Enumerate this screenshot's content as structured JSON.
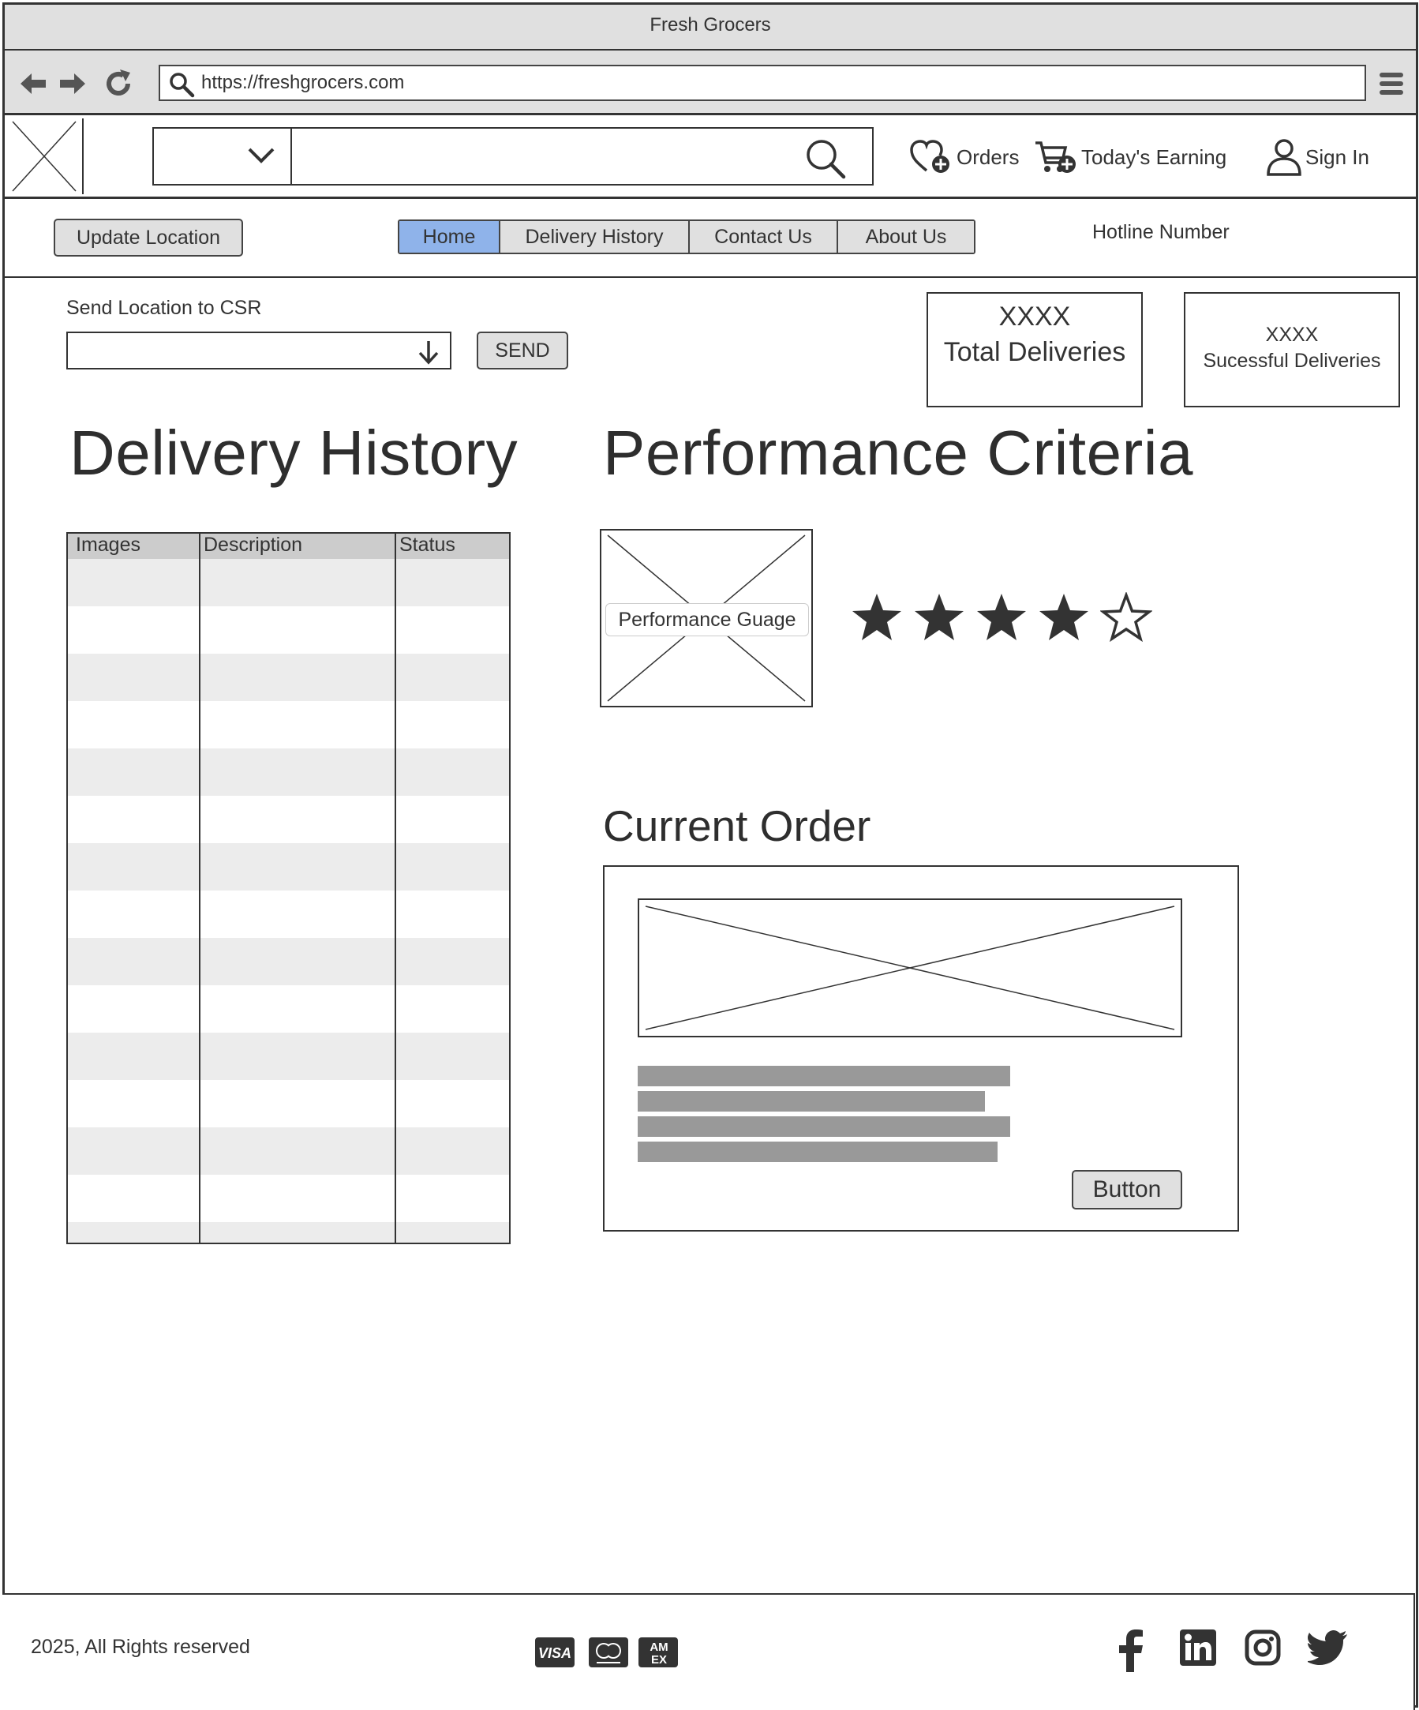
{
  "browser": {
    "title": "Fresh Grocers",
    "url": "https://freshgrocers.com"
  },
  "header": {
    "orders_label": "Orders",
    "earning_label": "Today's Earning",
    "signin_label": "Sign In"
  },
  "subnav": {
    "update_location": "Update Location",
    "tabs": [
      "Home",
      "Delivery History",
      "Contact Us",
      "About Us"
    ],
    "active_tab": "Home",
    "hotline": "Hotline Number"
  },
  "location": {
    "label": "Send Location to CSR",
    "send_button": "SEND"
  },
  "stats": {
    "total_value": "XXXX",
    "total_label": "Total Deliveries",
    "success_value": "XXXX",
    "success_label": "Sucessful Deliveries"
  },
  "delivery_history": {
    "title": "Delivery History",
    "columns": [
      "Images",
      "Description",
      "Status"
    ]
  },
  "performance": {
    "title": "Performance Criteria",
    "gauge_label": "Performance Guage",
    "rating": 4,
    "rating_max": 5
  },
  "current_order": {
    "title": "Current Order",
    "button_label": "Button"
  },
  "footer": {
    "copyright": "2025, All Rights reserved",
    "payment_icons": [
      "visa-icon",
      "mastercard-icon",
      "amex-icon"
    ],
    "social_icons": [
      "facebook-icon",
      "linkedin-icon",
      "instagram-icon",
      "twitter-icon"
    ]
  },
  "colors": {
    "active_tab": "#8fb3ea",
    "button_bg": "#e0e0e0",
    "text_bar": "#999999"
  }
}
